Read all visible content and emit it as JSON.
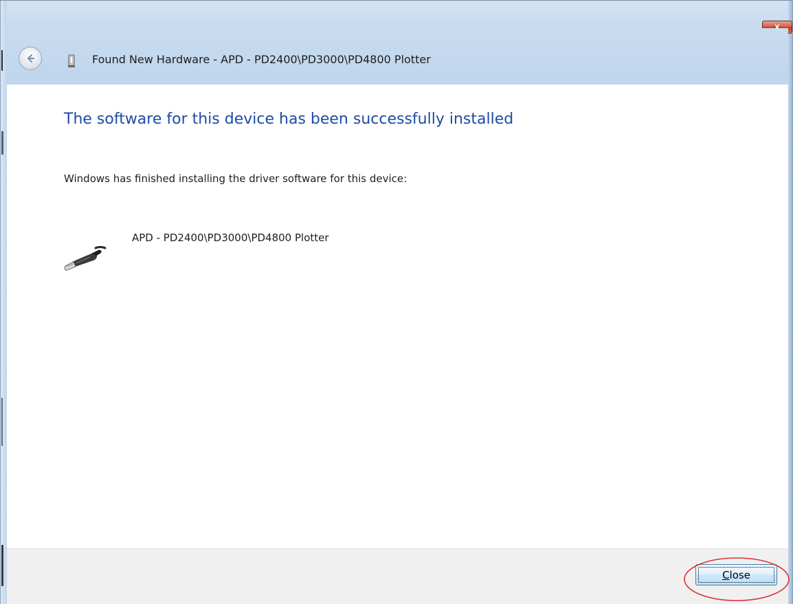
{
  "window": {
    "title_close_glyph": "x",
    "header": {
      "title": "Found New Hardware - APD - PD2400\\PD3000\\PD4800 Plotter",
      "back_icon": "back-arrow-icon",
      "hardware_icon": "hardware-device-icon"
    },
    "content": {
      "heading": "The software for this device has been successfully installed",
      "message": "Windows has finished installing the driver software for this device:",
      "device": {
        "icon": "usb-plug-icon",
        "name": "APD - PD2400\\PD3000\\PD4800 Plotter"
      }
    },
    "footer": {
      "close_button": {
        "mnemonic": "C",
        "rest": "lose"
      }
    },
    "annotation_color": "#e03030"
  }
}
